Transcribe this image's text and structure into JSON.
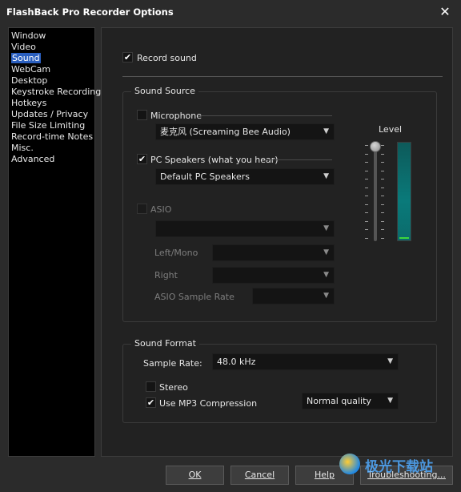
{
  "window": {
    "title": "FlashBack Pro Recorder Options",
    "close_glyph": "✕"
  },
  "nav": {
    "items": [
      "Window",
      "Video",
      "Sound",
      "WebCam",
      "Desktop",
      "Keystroke Recording",
      "Hotkeys",
      "Updates / Privacy",
      "File Size Limiting",
      "Record-time Notes",
      "Misc.",
      "Advanced"
    ],
    "selected": "Sound"
  },
  "sound": {
    "record_sound": {
      "label": "Record sound",
      "checked": true
    },
    "source_group_title": "Sound Source",
    "microphone": {
      "label": "Microphone",
      "checked": false,
      "device": "麦克风 (Screaming Bee Audio)"
    },
    "pc_speakers": {
      "label": "PC Speakers (what you hear)",
      "checked": true,
      "device": "Default PC Speakers"
    },
    "asio": {
      "label": "ASIO",
      "checked": false,
      "enabled": false,
      "device": "",
      "left_mono_label": "Left/Mono",
      "right_label": "Right",
      "sample_rate_label": "ASIO Sample Rate"
    },
    "level": {
      "label": "Level",
      "slider_fraction": 1.0,
      "meter_fraction": 0.02
    },
    "format_group_title": "Sound Format",
    "sample_rate": {
      "label": "Sample Rate:",
      "value": "48.0 kHz"
    },
    "stereo": {
      "label": "Stereo",
      "checked": false
    },
    "mp3": {
      "label": "Use MP3 Compression",
      "checked": true,
      "quality": "Normal quality"
    }
  },
  "buttons": {
    "ok": "OK",
    "cancel": "Cancel",
    "help": "Help",
    "troubleshooting": "Troubleshooting..."
  },
  "watermark": {
    "text": "极光下载站"
  },
  "colors": {
    "accent": "#2a5fbf",
    "meter": "#0a7a7a",
    "meter_level": "#3dd63d"
  },
  "icons": {
    "check": "✔",
    "chevron": "▼"
  }
}
